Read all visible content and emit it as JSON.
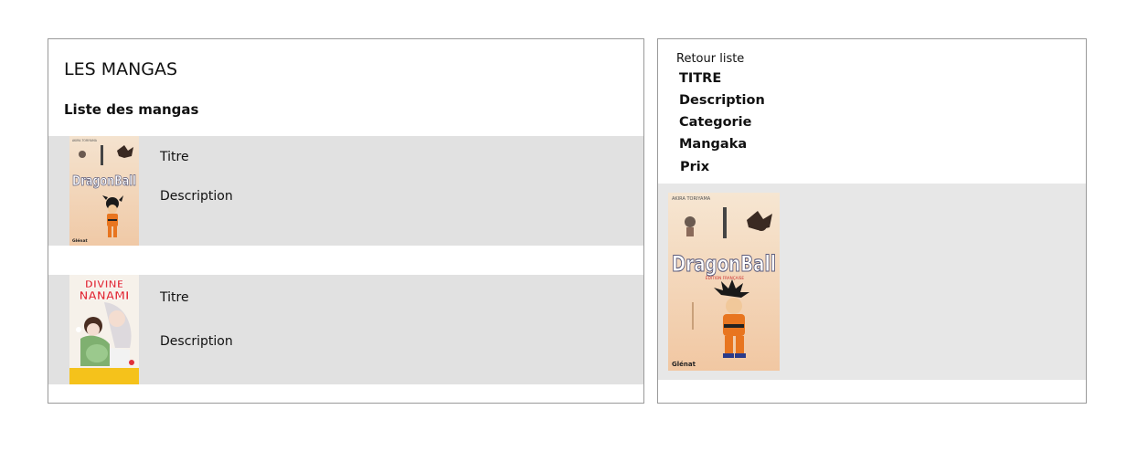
{
  "list": {
    "title": "LES MANGAS",
    "heading": "Liste des mangas",
    "items": [
      {
        "cover_title": "DragonBall",
        "cover_author": "AKIRA TORIYAMA",
        "title_label": "Titre",
        "description_label": "Description"
      },
      {
        "cover_title_line1": "DIVINE",
        "cover_title_line2": "NANAMI",
        "title_label": "Titre",
        "description_label": "Description"
      }
    ]
  },
  "detail": {
    "back_link": "Retour liste",
    "fields": {
      "titre": "TITRE",
      "description": "Description",
      "categorie": "Categorie",
      "mangaka": "Mangaka",
      "prix": "Prix"
    },
    "cover": {
      "author": "AKIRA TORIYAMA",
      "title": "DragonBall",
      "subtitle": "ÉDITION FRANÇAISE",
      "publisher": "Glénat"
    }
  },
  "colors": {
    "row_bg": "#e1e1e1",
    "detail_bg": "#e7e7e7",
    "border": "#9a9a9a"
  }
}
